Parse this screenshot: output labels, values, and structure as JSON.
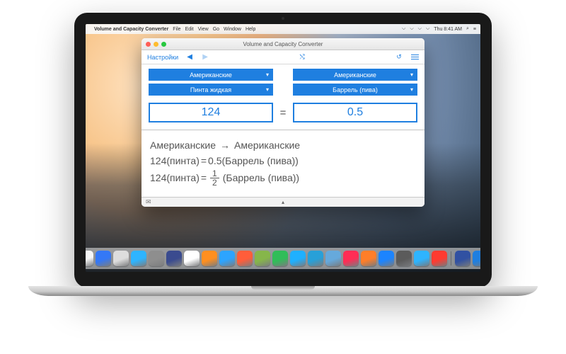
{
  "menubar": {
    "apple_icon": "",
    "app_name": "Volume and Capacity Converter",
    "items": [
      "File",
      "Edit",
      "View",
      "Go",
      "Window",
      "Help"
    ],
    "clock": "Thu 8:41 AM",
    "status_icons": [
      "bluetooth-icon",
      "wifi-icon",
      "volume-icon",
      "battery-icon"
    ]
  },
  "window": {
    "title": "Volume and Capacity Converter",
    "toolbar": {
      "settings_label": "Настройки",
      "back_icon": "◀",
      "forward_icon": "▶",
      "swap_icon": "⤭",
      "undo_icon": "↺",
      "menu_icon": "menu-icon"
    },
    "left": {
      "system_label": "Американские",
      "unit_label": "Пинта жидкая",
      "value": "124"
    },
    "right": {
      "system_label": "Американские",
      "unit_label": "Баррель (пива)",
      "value": "0.5"
    },
    "equals": "=",
    "result": {
      "from_system": "Американские",
      "to_system": "Американские",
      "arrow": "→",
      "line_decimal_lhs": "124(пинта)",
      "line_decimal_eq": " = ",
      "line_decimal_rhs": "0.5(Баррель (пива))",
      "line_fraction_lhs": "124(пинта)",
      "line_fraction_eq": " = ",
      "fraction_num": "1",
      "fraction_den": "2",
      "line_fraction_rhs": "(Баррель (пива))"
    },
    "footer": {
      "mail_icon": "✉",
      "expand_icon": "▴"
    }
  },
  "dock": {
    "colors": [
      "#f7f7f7",
      "#3478f6",
      "#dddddd",
      "#2eb4ff",
      "#8e8e8e",
      "#3a4b8f",
      "#ffffff",
      "#ff8f1f",
      "#2da4ff",
      "#ff5d3a",
      "#86b64a",
      "#31bd59",
      "#1fb0ff",
      "#28a0d8",
      "#66a9dc",
      "#ff2d55",
      "#ff7e29",
      "#1c84ff",
      "#5b5b5b",
      "#2eb4ff",
      "#ff3b30",
      "#3151a2",
      "#1F7FE0"
    ]
  }
}
